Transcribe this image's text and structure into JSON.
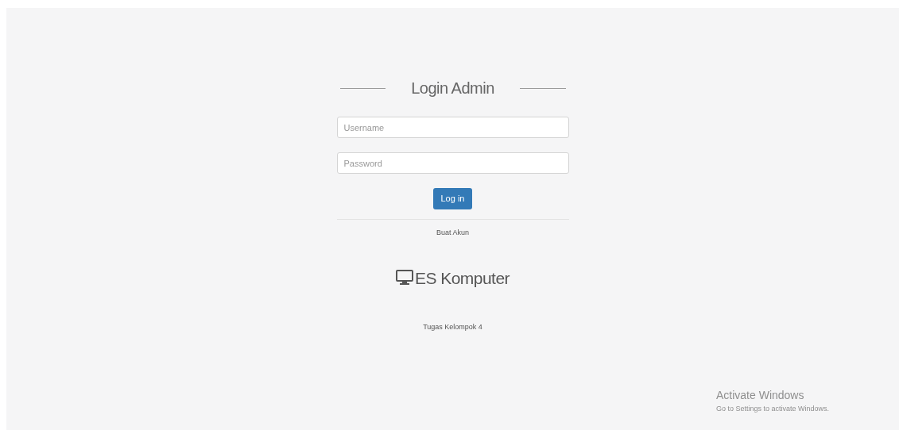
{
  "login": {
    "title": "Login Admin",
    "username": {
      "placeholder": "Username"
    },
    "password": {
      "placeholder": "Password"
    },
    "button": "Log in",
    "register_link": "Buat Akun"
  },
  "brand": "ES Komputer",
  "footer": "Tugas Kelompok 4",
  "os_overlay": {
    "title": "Activate Windows",
    "subtitle": "Go to Settings to activate Windows."
  }
}
